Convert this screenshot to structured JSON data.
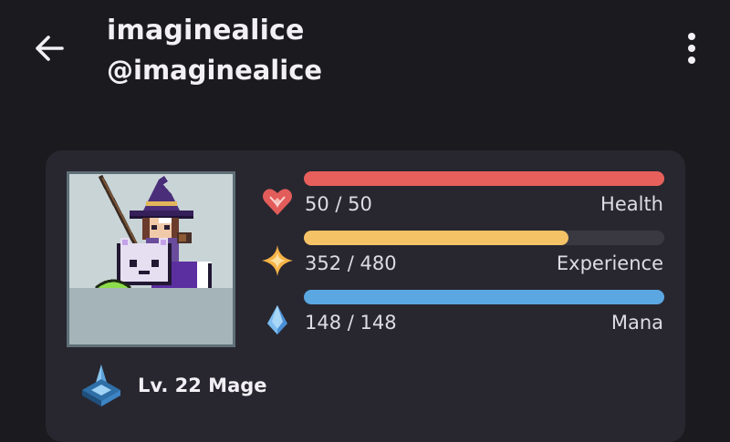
{
  "header": {
    "display_name": "imaginealice",
    "username": "@imaginealice",
    "back_icon": "arrow-left-icon",
    "menu_icon": "more-vertical-icon"
  },
  "profile": {
    "avatar_alt": "Pixel-art mage avatar with witch hat riding a white cat mount beside a green ghost pet",
    "stats": [
      {
        "name": "health",
        "value_text": "50 / 50",
        "label": "Health",
        "current": 50,
        "max": 50,
        "color": "#e8605c",
        "icon": "heart-icon"
      },
      {
        "name": "experience",
        "value_text": "352 / 480",
        "label": "Experience",
        "current": 352,
        "max": 480,
        "color": "#f5c266",
        "icon": "star-sparkle-icon"
      },
      {
        "name": "mana",
        "value_text": "148 / 148",
        "label": "Mana",
        "current": 148,
        "max": 148,
        "color": "#5ba7e2",
        "icon": "crystal-icon"
      }
    ],
    "class_label": "Lv. 22 Mage",
    "class_icon": "mage-class-icon"
  }
}
